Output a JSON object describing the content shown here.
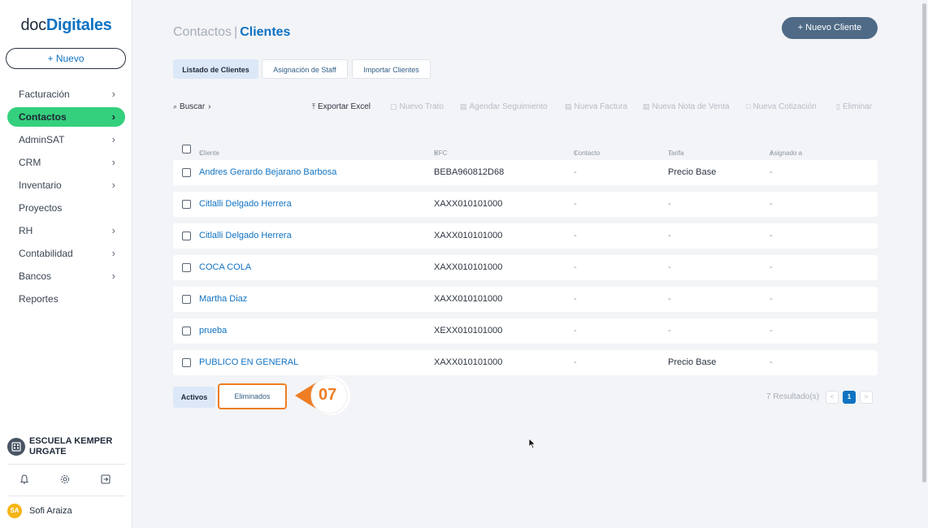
{
  "brand": {
    "logo_part1": "doc",
    "logo_part2": "Digitales"
  },
  "sidebar": {
    "new_label": "+ Nuevo",
    "items": [
      {
        "label": "Facturación",
        "chevron": true,
        "active": false
      },
      {
        "label": "Contactos",
        "chevron": true,
        "active": true
      },
      {
        "label": "AdminSAT",
        "chevron": true,
        "active": false
      },
      {
        "label": "CRM",
        "chevron": true,
        "active": false
      },
      {
        "label": "Inventario",
        "chevron": true,
        "active": false
      },
      {
        "label": "Proyectos",
        "chevron": false,
        "active": false
      },
      {
        "label": "RH",
        "chevron": true,
        "active": false
      },
      {
        "label": "Contabilidad",
        "chevron": true,
        "active": false
      },
      {
        "label": "Bancos",
        "chevron": true,
        "active": false
      },
      {
        "label": "Reportes",
        "chevron": false,
        "active": false
      }
    ],
    "company": "ESCUELA KEMPER URGATE",
    "user": {
      "initials": "SA",
      "name": "Sofi Araiza"
    },
    "bottom_icons": [
      "bell-icon",
      "gear-icon",
      "logout-icon"
    ]
  },
  "header": {
    "title_section": "Contactos",
    "title_separator": "|",
    "title_page": "Clientes",
    "new_client_button": "+ Nuevo Cliente"
  },
  "tabs": [
    {
      "label": "Listado de Clientes",
      "active": true
    },
    {
      "label": "Asignación de Staff",
      "active": false
    },
    {
      "label": "Importar Clientes",
      "active": false
    }
  ],
  "toolbar": {
    "search": "Buscar",
    "export": "Exportar Excel",
    "new_deal": "Nuevo Trato",
    "schedule": "Agendar Seguimiento",
    "new_invoice": "Nueva Factura",
    "new_sale_note": "Nueva Nota de Venta",
    "new_quote": "Nueva Cotización",
    "delete": "Eliminar"
  },
  "table": {
    "columns": [
      "Cliente",
      "RFC",
      "Contacto",
      "Tarifa",
      "Asignado a"
    ],
    "rows": [
      [
        "Andres Gerardo Bejarano Barbosa",
        "BEBA960812D68",
        "-",
        "Precio Base",
        "-"
      ],
      [
        "Citlalli Delgado Herrera",
        "XAXX010101000",
        "-",
        "-",
        "-"
      ],
      [
        "Citlalli Delgado Herrera",
        "XAXX010101000",
        "-",
        "-",
        "-"
      ],
      [
        "COCA COLA",
        "XAXX010101000",
        "-",
        "-",
        "-"
      ],
      [
        "Martha Diaz",
        "XAXX010101000",
        "-",
        "-",
        "-"
      ],
      [
        "prueba",
        "XEXX010101000",
        "-",
        "-",
        "-"
      ],
      [
        "PUBLICO EN GENERAL",
        "XAXX010101000",
        "-",
        "Precio Base",
        "-"
      ]
    ]
  },
  "status_tabs": {
    "active": "Activos",
    "deleted": "Eliminados"
  },
  "step_callout": "07",
  "pagination": {
    "results": "7 Resultado(s)",
    "prev": "<",
    "current": "1",
    "next": ">"
  },
  "colors": {
    "accent": "#0f72c2",
    "active_nav": "#34d07d",
    "callout": "#ee7d23",
    "primary_button": "#4f6a86"
  }
}
